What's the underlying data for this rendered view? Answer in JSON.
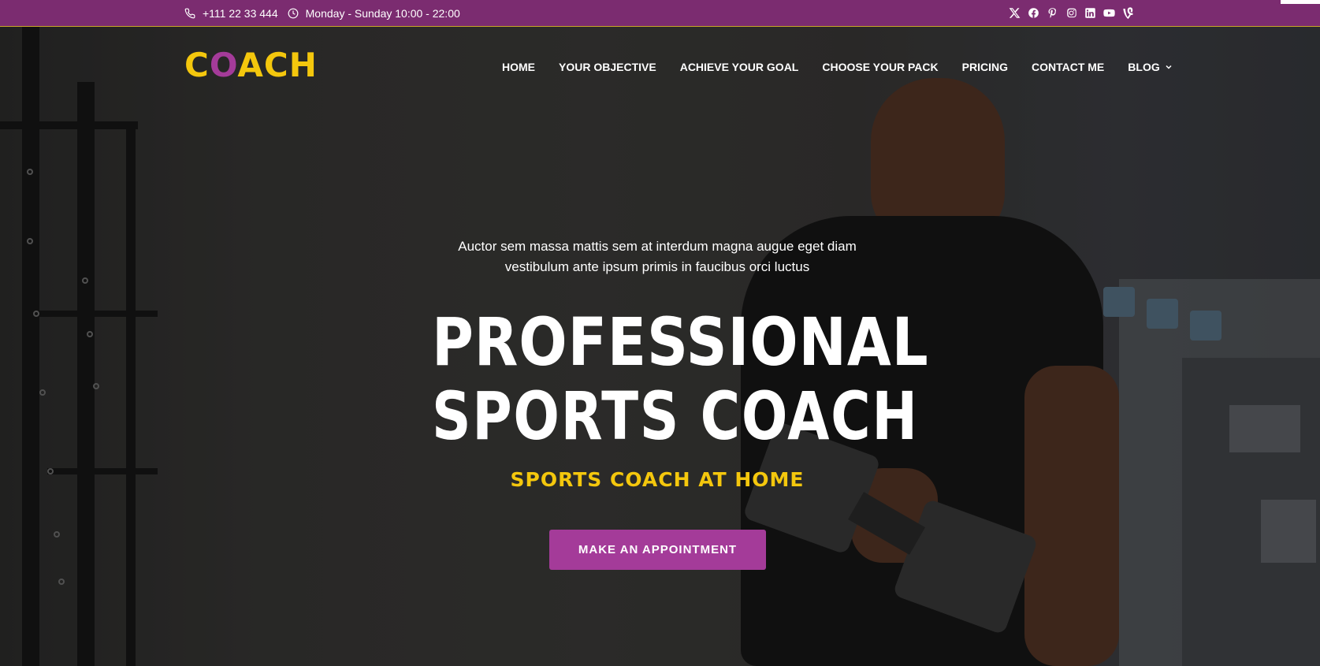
{
  "topbar": {
    "phone": "+111 22 33 444",
    "hours": "Monday - Sunday 10:00 - 22:00",
    "socials": [
      "x-icon",
      "facebook-icon",
      "pinterest-icon",
      "instagram-icon",
      "linkedin-icon",
      "youtube-icon",
      "vine-icon"
    ]
  },
  "logo": {
    "part1": "C",
    "part2": "O",
    "part3": "ACH"
  },
  "nav": {
    "items": [
      {
        "label": "HOME"
      },
      {
        "label": "YOUR OBJECTIVE"
      },
      {
        "label": "ACHIEVE YOUR GOAL"
      },
      {
        "label": "CHOOSE YOUR PACK"
      },
      {
        "label": "PRICING"
      },
      {
        "label": "CONTACT ME"
      },
      {
        "label": "BLOG"
      }
    ]
  },
  "hero": {
    "intro_line1": "Auctor sem massa mattis sem at interdum magna augue eget diam",
    "intro_line2": "vestibulum ante ipsum primis in faucibus orci luctus",
    "headline_1": "PROFESSIONAL",
    "headline_2": "SPORTS COACH",
    "subhead": "SPORTS COACH AT HOME",
    "cta": "MAKE AN APPOINTMENT"
  },
  "colors": {
    "topbar": "#7b2c70",
    "accent_yellow": "#f4c70d",
    "accent_purple": "#a43b99"
  }
}
